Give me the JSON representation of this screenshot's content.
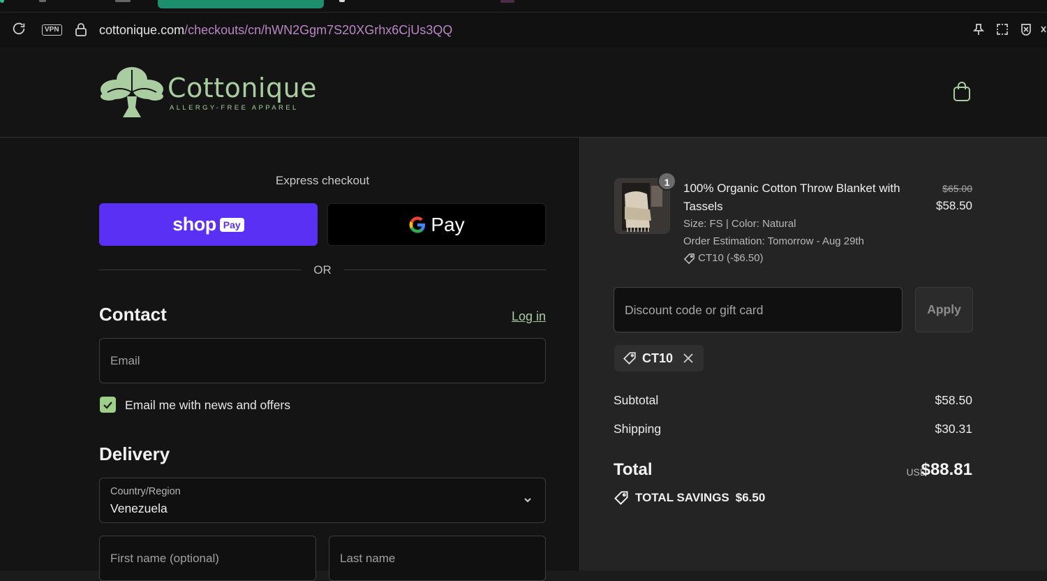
{
  "browser": {
    "url_host": "cottonique.com",
    "url_path": "/checkouts/cn/hWN2Ggm7S20XGrhx6CjUs3QQ",
    "vpn_label": "VPN",
    "accent": "#1e8f6e"
  },
  "store": {
    "name": "Cottonique",
    "tagline": "ALLERGY-FREE APPAREL",
    "brand_color": "#a9cda0"
  },
  "express": {
    "label": "Express checkout",
    "shop_text": "shop",
    "shop_pay_badge": "Pay",
    "gpay_g": "G",
    "gpay_text": "Pay",
    "or_label": "OR"
  },
  "contact": {
    "heading": "Contact",
    "login_label": "Log in",
    "email_placeholder": "Email",
    "newsletter_label": "Email me with news and offers",
    "newsletter_checked": true
  },
  "delivery": {
    "heading": "Delivery",
    "country_label": "Country/Region",
    "country_value": "Venezuela",
    "first_name_placeholder": "First name (optional)",
    "last_name_placeholder": "Last name"
  },
  "summary": {
    "item": {
      "quantity": "1",
      "title": "100% Organic Cotton Throw Blanket with Tassels",
      "variant": "Size: FS | Color: Natural",
      "estimation": "Order Estimation: Tomorrow - Aug 29th",
      "discount_line": "CT10 (-$6.50)",
      "original_price": "$65.00",
      "price": "$58.50"
    },
    "discount_placeholder": "Discount code or gift card",
    "apply_label": "Apply",
    "applied_code": "CT10",
    "subtotal_label": "Subtotal",
    "subtotal_value": "$58.50",
    "shipping_label": "Shipping",
    "shipping_value": "$30.31",
    "total_label": "Total",
    "total_currency": "USD",
    "total_value": "$88.81",
    "savings_label": "TOTAL SAVINGS",
    "savings_value": "$6.50"
  }
}
